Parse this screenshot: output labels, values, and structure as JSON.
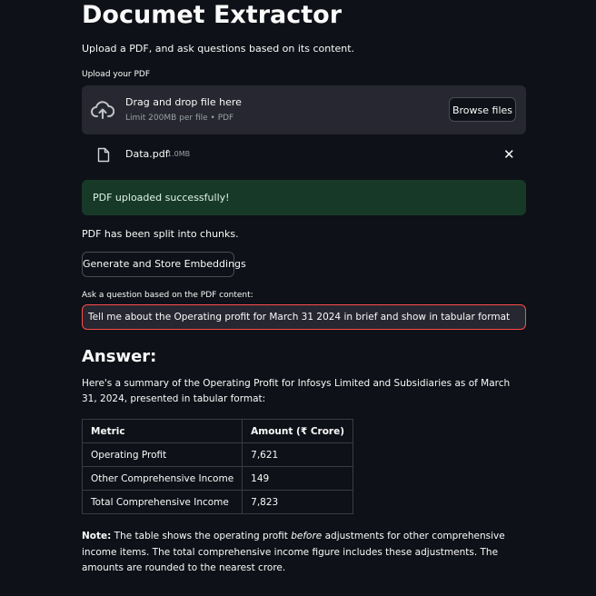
{
  "title": "Documet Extractor",
  "subtitle": "Upload a PDF, and ask questions based on its content.",
  "uploader": {
    "label": "Upload your PDF",
    "drop_text": "Drag and drop file here",
    "limit_text": "Limit 200MB per file • PDF",
    "browse_label": "Browse files",
    "file": {
      "name": "Data.pdf",
      "size": "1.0MB",
      "remove_symbol": "✕"
    }
  },
  "success_message": "PDF uploaded successfully!",
  "chunks_message": "PDF has been split into chunks.",
  "embeddings_button": "Generate and Store Embeddings",
  "question": {
    "label": "Ask a question based on the PDF content:",
    "value": "Tell me about the Operating profit for March 31 2024 in brief and show in tabular format"
  },
  "answer": {
    "heading": "Answer:",
    "summary": "Here's a summary of the Operating Profit for Infosys Limited and Subsidiaries as of March 31, 2024, presented in tabular format:",
    "table": {
      "headers": [
        "Metric",
        "Amount (₹ Crore)"
      ],
      "rows": [
        [
          "Operating Profit",
          "7,621"
        ],
        [
          "Other Comprehensive Income",
          "149"
        ],
        [
          "Total Comprehensive Income",
          "7,823"
        ]
      ]
    },
    "note": {
      "label": "Note:",
      "part1": " The table shows the operating profit ",
      "emphasis": "before",
      "part2": " adjustments for other comprehensive income items. The total comprehensive income figure includes these adjustments. The amounts are rounded to the nearest crore."
    }
  },
  "colors": {
    "background": "#0e1117",
    "surface": "#262730",
    "success_bg": "#173928",
    "focus_border": "#ff4b4b"
  }
}
